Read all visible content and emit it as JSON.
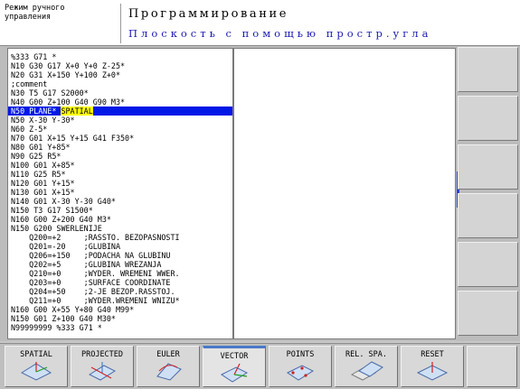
{
  "header": {
    "mode_line1": "Режим ручного",
    "mode_line2": "управления",
    "title": "Программирование",
    "subtitle": "Плоскость с помощью простр.угла"
  },
  "program": {
    "lines": [
      "%333 G71 *",
      "N10 G30 G17 X+0 Y+0 Z-25*",
      "N20 G31 X+150 Y+100 Z+0*",
      ";comment",
      "N30 T5 G17 S2000*",
      "N40 G00 Z+100 G40 G90 M3*",
      "N50 PLANE* ",
      "N50 X-30 Y-30*",
      "N60 Z-5*",
      "N70 G01 X+15 Y+15 G41 F350*",
      "N80 G01 Y+85*",
      "N90 G25 R5*",
      "N100 G01 X+85*",
      "N110 G25 R5*",
      "N120 G01 Y+15*",
      "N130 G01 X+15*",
      "N140 G01 X-30 Y-30 G40*",
      "N150 T3 G17 S1500*",
      "N160 G00 Z+200 G40 M3*",
      "N150 G200 SWERLENIJE",
      "    Q200=+2     ;RASSTO. BEZOPASNOSTI",
      "    Q201=-20    ;GLUBINA",
      "    Q206=+150   ;PODACHA NA GLUBINU",
      "    Q202=+5     ;GLUBINA WREZANJA",
      "    Q210=+0     ;WYDER. WREMENI WWER.",
      "    Q203=+0     ;SURFACE COORDINATE",
      "    Q204=+50    ;2-JE BEZOP.RASSTOJ.",
      "    Q211=+0     ;WYDER.WREMENI WNIZU*",
      "N160 G00 X+55 Y+80 G40 M99*",
      "N150 G01 Z+100 G40 M30*",
      "N99999999 %333 G71 *"
    ],
    "selected_index": 6,
    "selected_highlight": "SPATIAL"
  },
  "softkeys": [
    {
      "label": "SPATIAL",
      "icon": "plane-spatial-icon"
    },
    {
      "label": "PROJECTED",
      "icon": "plane-projected-icon"
    },
    {
      "label": "EULER",
      "icon": "plane-euler-icon"
    },
    {
      "label": "VECTOR",
      "icon": "plane-vector-icon"
    },
    {
      "label": "POINTS",
      "icon": "plane-points-icon"
    },
    {
      "label": "REL. SPA.",
      "icon": "plane-relspa-icon"
    },
    {
      "label": "RESET",
      "icon": "plane-reset-icon"
    }
  ],
  "active_softkey": 3,
  "colors": {
    "selection": "#0018e6",
    "highlight": "#ffff00",
    "subtitle": "#1a1ab4"
  }
}
